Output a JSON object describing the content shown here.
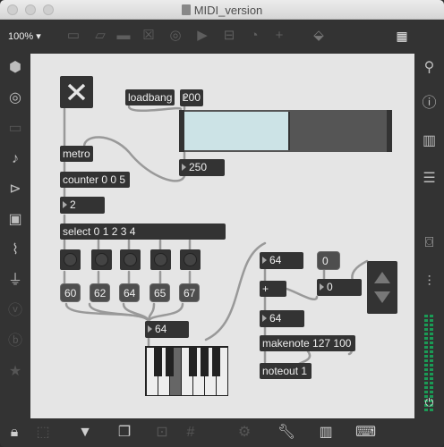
{
  "window": {
    "title": "MIDI_version"
  },
  "toolbar": {
    "zoom": "100%"
  },
  "objects": {
    "loadbang": "loadbang",
    "metro": "metro",
    "counter": "counter 0 0 5",
    "select": "select 0 1 2 3 4",
    "makenote": "makenote 127 100",
    "noteout": "noteout 1",
    "plus": "+"
  },
  "numbers": {
    "loadbang_value": "200",
    "slider_value": "250",
    "counter_out": "2",
    "note_in": "64",
    "plus_right": "0",
    "plus_out": "64",
    "piano_note": "64"
  },
  "messages": [
    "60",
    "62",
    "64",
    "65",
    "67"
  ],
  "message_zero": "0",
  "slider": {
    "level": 0.52
  }
}
